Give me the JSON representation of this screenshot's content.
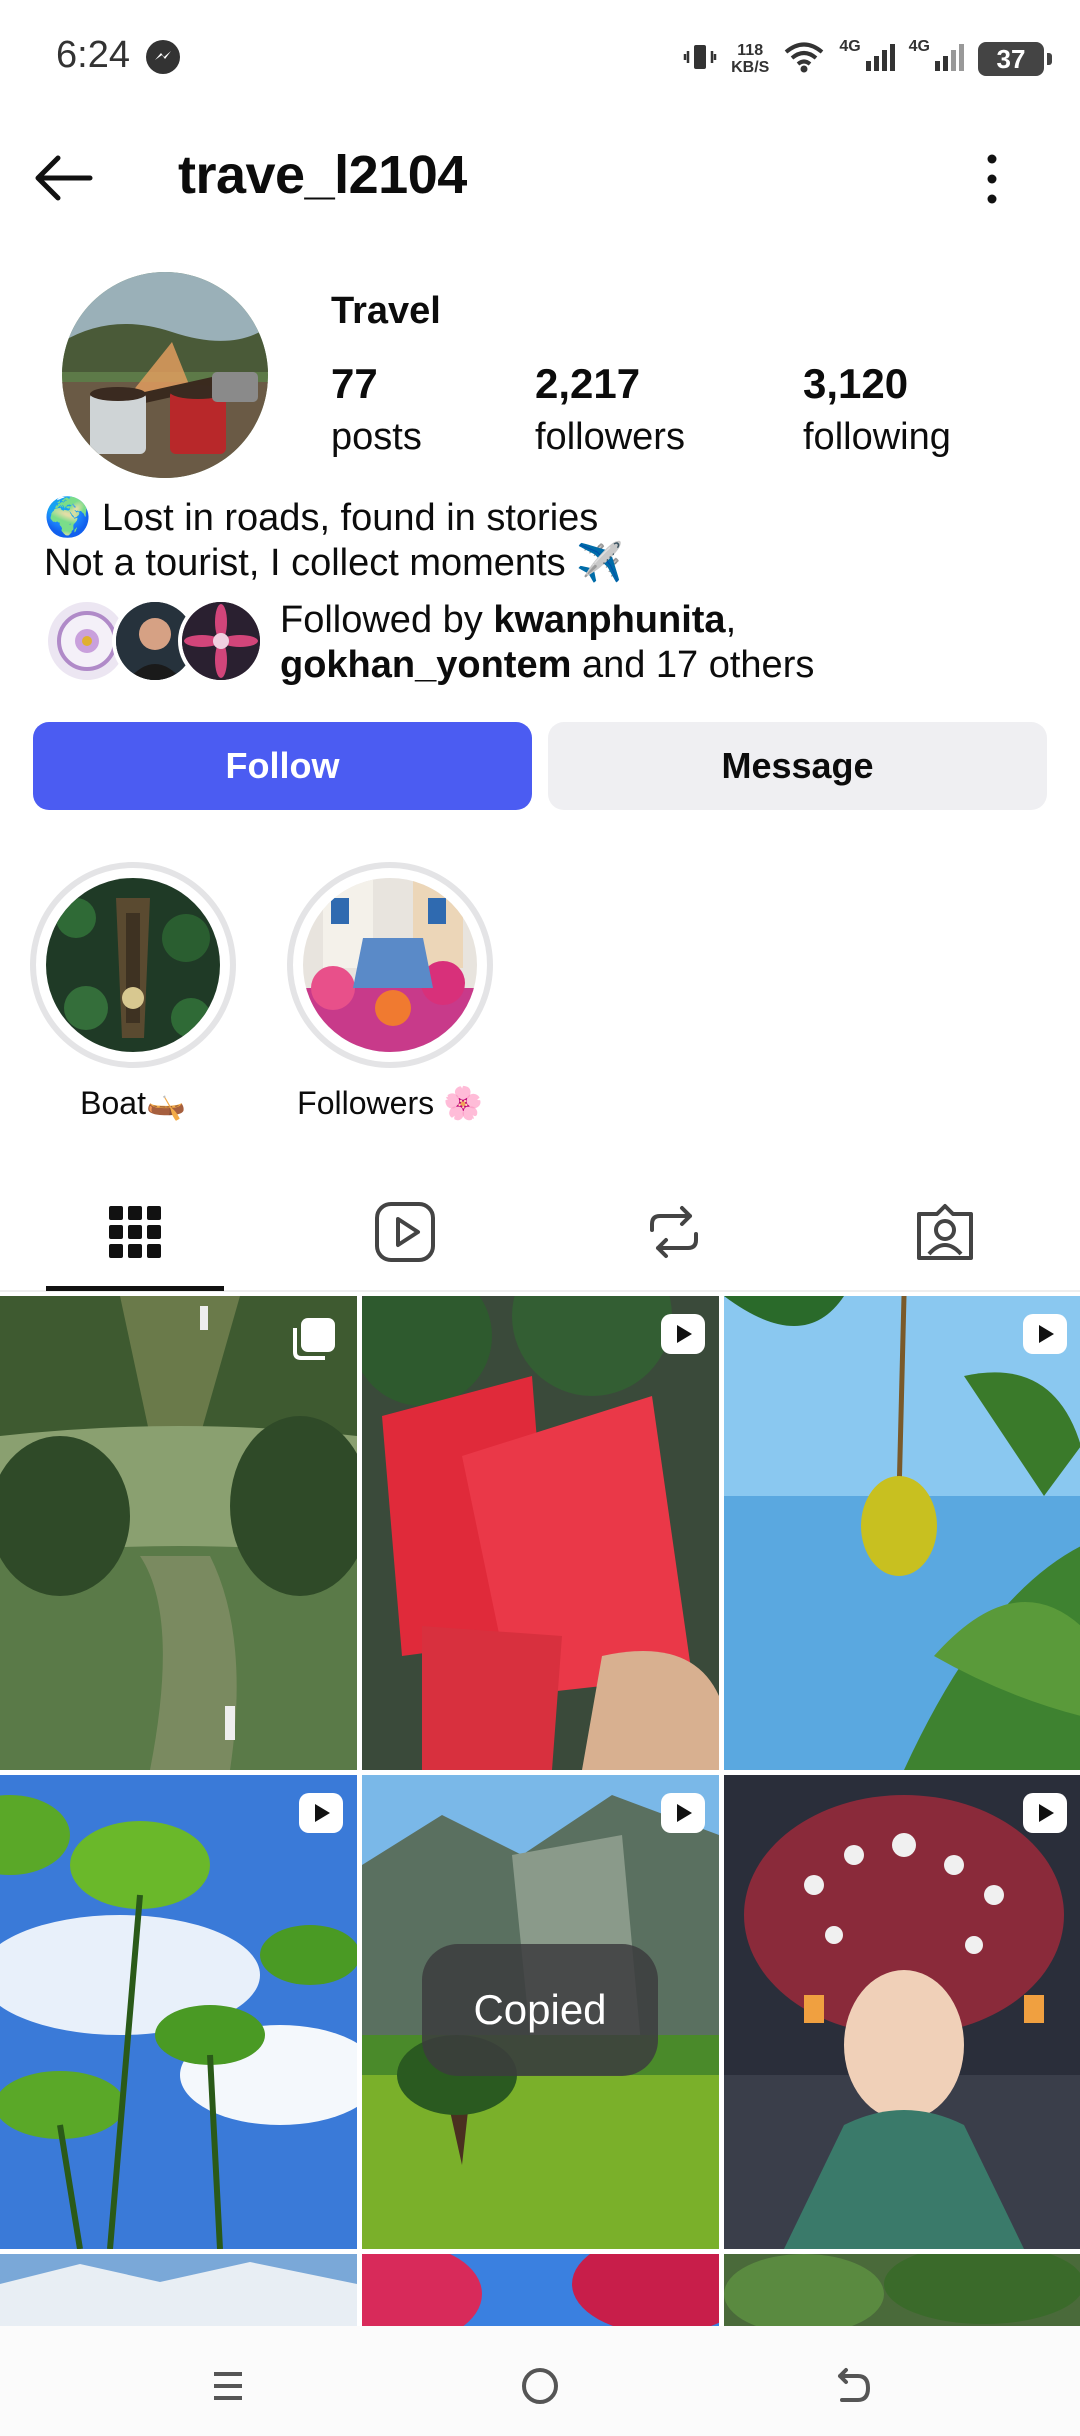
{
  "status_bar": {
    "time": "6:24",
    "net_speed_value": "118",
    "net_speed_unit": "KB/S",
    "signal1_label": "4G",
    "signal2_label": "4G",
    "battery": "37"
  },
  "header": {
    "username": "trave_l2104"
  },
  "profile": {
    "display_name": "Travel",
    "stats": [
      {
        "num": "77",
        "label": "posts"
      },
      {
        "num": "2,217",
        "label": "followers"
      },
      {
        "num": "3,120",
        "label": "following"
      }
    ],
    "bio_line1": "🌍 Lost in roads, found in stories",
    "bio_line2": "Not a tourist, I collect moments ✈️",
    "followed_prefix": "Followed by ",
    "followed_user1": "kwanphunita",
    "followed_sep": ",",
    "followed_user2": "gokhan_yontem",
    "followed_suffix": " and 17 others"
  },
  "actions": {
    "follow_label": "Follow",
    "message_label": "Message"
  },
  "highlights": [
    {
      "label": "Boat🛶"
    },
    {
      "label": "Followers 🌸"
    }
  ],
  "tabs": [
    {
      "icon": "grid-icon",
      "active": true
    },
    {
      "icon": "reels-icon",
      "active": false
    },
    {
      "icon": "reposts-icon",
      "active": false
    },
    {
      "icon": "tagged-icon",
      "active": false
    }
  ],
  "grid_posts": [
    {
      "type": "carousel",
      "scene": "forest road"
    },
    {
      "type": "reel",
      "scene": "watermelon"
    },
    {
      "type": "reel",
      "scene": "mango"
    },
    {
      "type": "reel",
      "scene": "lotus leaves"
    },
    {
      "type": "reel",
      "scene": "mountain meadow"
    },
    {
      "type": "reel",
      "scene": "flower woman"
    }
  ],
  "toast": {
    "text": "Copied"
  },
  "colors": {
    "follow_button": "#4b5cf2",
    "message_button": "#efeff2"
  }
}
